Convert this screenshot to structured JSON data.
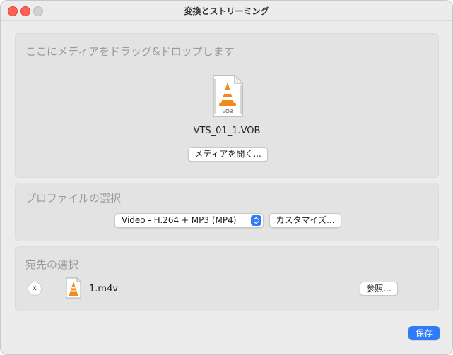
{
  "window": {
    "title": "変換とストリーミング"
  },
  "drop_zone": {
    "heading": "ここにメディアをドラッグ&ドロップします",
    "file_icon_label": "VOB",
    "file_name": "VTS_01_1.VOB",
    "open_button": "メディアを開く..."
  },
  "profile": {
    "heading": "プロファイルの選択",
    "selected": "Video - H.264 + MP3 (MP4)",
    "customize_button": "カスタマイズ..."
  },
  "destination": {
    "heading": "宛先の選択",
    "remove_label": "x",
    "file_name": "1.m4v",
    "browse_button": "参照..."
  },
  "save_button": "保存",
  "colors": {
    "accent": "#2f7cf6",
    "vlc_orange": "#f08a1c",
    "close": "#ff5f57"
  },
  "icons": {
    "file": "vlc-file-icon",
    "dest": "vlc-cone-icon",
    "select": "chevron-updown-icon"
  }
}
